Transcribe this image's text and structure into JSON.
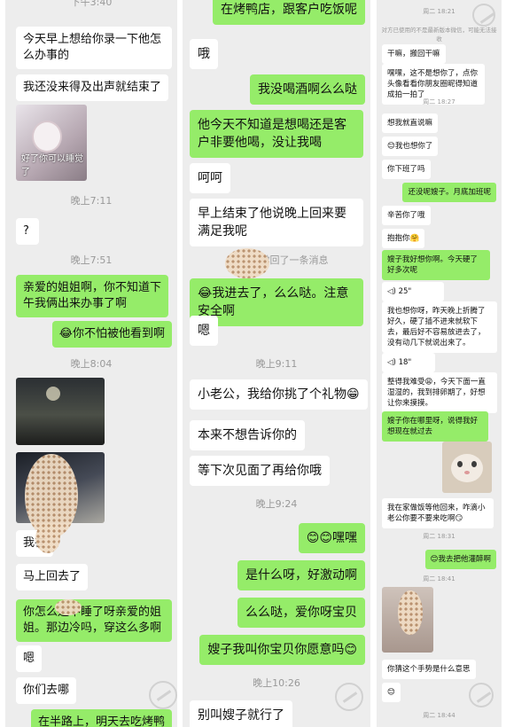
{
  "col1": {
    "top_time": "下午3:40",
    "m1": "今天早上想给你录一下他怎么办事的",
    "m2": "我还没来得及出声就结束了",
    "img_caption": "好了你可以睡觉了",
    "t1": "晚上7:11",
    "m3": "?",
    "t2": "晚上7:51",
    "m4": "亲爱的姐姐啊，你不知道下午我俩出来办事了啊",
    "m5": "😂你不怕被他看到啊",
    "t3": "晚上8:04",
    "m6": "我在",
    "m7": "马上回去了",
    "m8": "你怎么还不睡了呀亲爱的姐姐。那边冷吗，穿这么多啊",
    "m9": "嗯",
    "m10": "你们去哪",
    "m11": "在半路上，明天去吃烤鸭"
  },
  "col2": {
    "m1": "在烤鸭店，跟客户吃饭呢",
    "m2": "哦",
    "m3": "我没喝酒啊么么哒",
    "m4": "他今天不知道是想喝还是客户非要他喝，没让我喝",
    "m5": "呵呵",
    "m6": "早上结束了他说晚上回来要满足我呢",
    "recall": "撤回了一条消息",
    "m7": "😂我进去了，么么哒。注意安全啊",
    "m8": "嗯",
    "t1": "晚上9:11",
    "m9": "小老公，我给你挑了个礼物😁",
    "m10": "本来不想告诉你的",
    "m11": "等下次见面了再给你哦",
    "t2": "晚上9:24",
    "m12": "😊😊嘿嘿",
    "m13": "是什么呀，好激动啊",
    "m14": "么么哒，爱你呀宝贝",
    "m15": "嫂子我叫你宝贝你愿意吗😊",
    "t3": "晚上10:26",
    "m16": "别叫嫂子就行了"
  },
  "col3": {
    "t1": "周二 18:21",
    "notice": "对方已使用的不是最新版本微信，可能无法接收",
    "m1": "干嘛，搬回干嘛",
    "m2": "嘿嘿，这不是想你了，点你头像看看你朋友圈昵得知道成拍一拍了",
    "t2": "周二 18:27",
    "m3": "想我就直说嘛",
    "m4": "😊我也想你了",
    "m5": "你下班了吗",
    "m6": "还没呢嫂子。月底加班呢",
    "m7": "辛苦你了哦",
    "m8": "抱抱你🤗",
    "m9": "嫂子我好想你啊。今天硬了好多次呢",
    "v1": "25\"",
    "m10": "我也想你呀，昨天晚上折腾了好久，硬了插不进来就软下去，最后好不容易放进去了，没有动几下就说出来了。",
    "v2": "18\"",
    "m11": "整得我难受😩，今天下面一直湿湿的，我到排卵期了，好想让你来摸摸。",
    "m12": "嫂子你在哪里呀，说得我好想现在就过去",
    "m13": "我在家做饭等他回来，咋滴小老公你要不要来吃啊😏",
    "t3": "周二 18:31",
    "m14": "😊我去把他灌醉啊",
    "t4": "周二 18:41",
    "m15": "你猜这个手势是什么意思",
    "m16": "😊",
    "t5": "周二 18:44"
  }
}
